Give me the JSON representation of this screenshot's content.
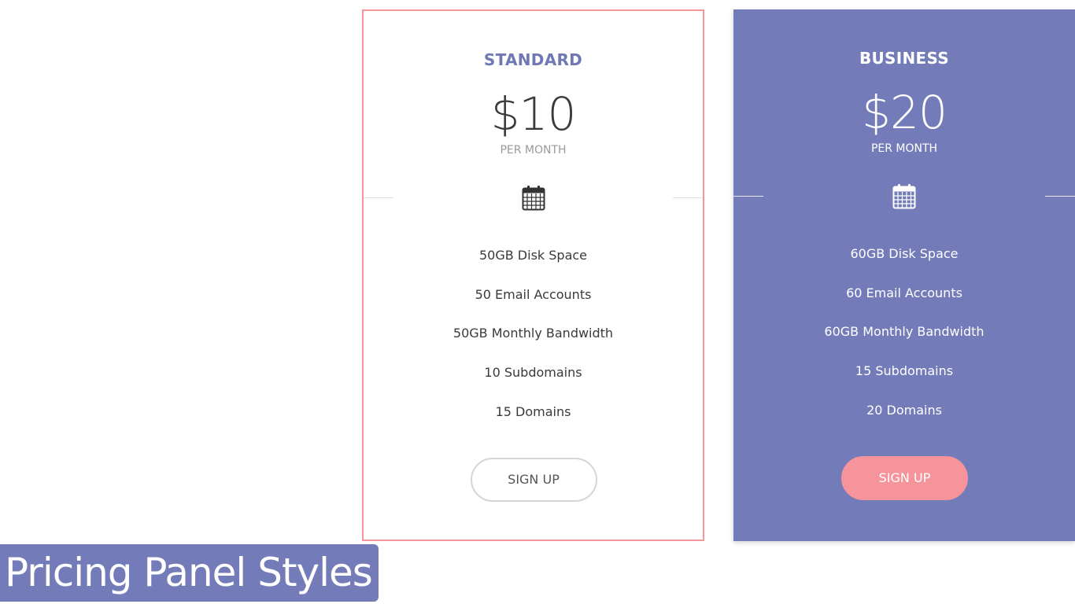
{
  "plans": [
    {
      "name": "STANDARD",
      "price": "$10",
      "period": "PER MONTH",
      "icon": "calendar-icon",
      "features": [
        "50GB Disk Space",
        "50 Email Accounts",
        "50GB Monthly Bandwidth",
        "10 Subdomains",
        "15 Domains"
      ],
      "button_label": "SIGN UP"
    },
    {
      "name": "BUSINESS",
      "price": "$20",
      "period": "PER MONTH",
      "icon": "calendar-icon",
      "features": [
        "60GB Disk Space",
        "60 Email Accounts",
        "60GB Monthly Bandwidth",
        "15 Subdomains",
        "20 Domains"
      ],
      "button_label": "SIGN UP"
    }
  ],
  "caption": "Pricing Panel Styles",
  "colors": {
    "accent_purple": "#737bb8",
    "accent_pink": "#f5949b",
    "standard_title": "#6f77b5"
  }
}
